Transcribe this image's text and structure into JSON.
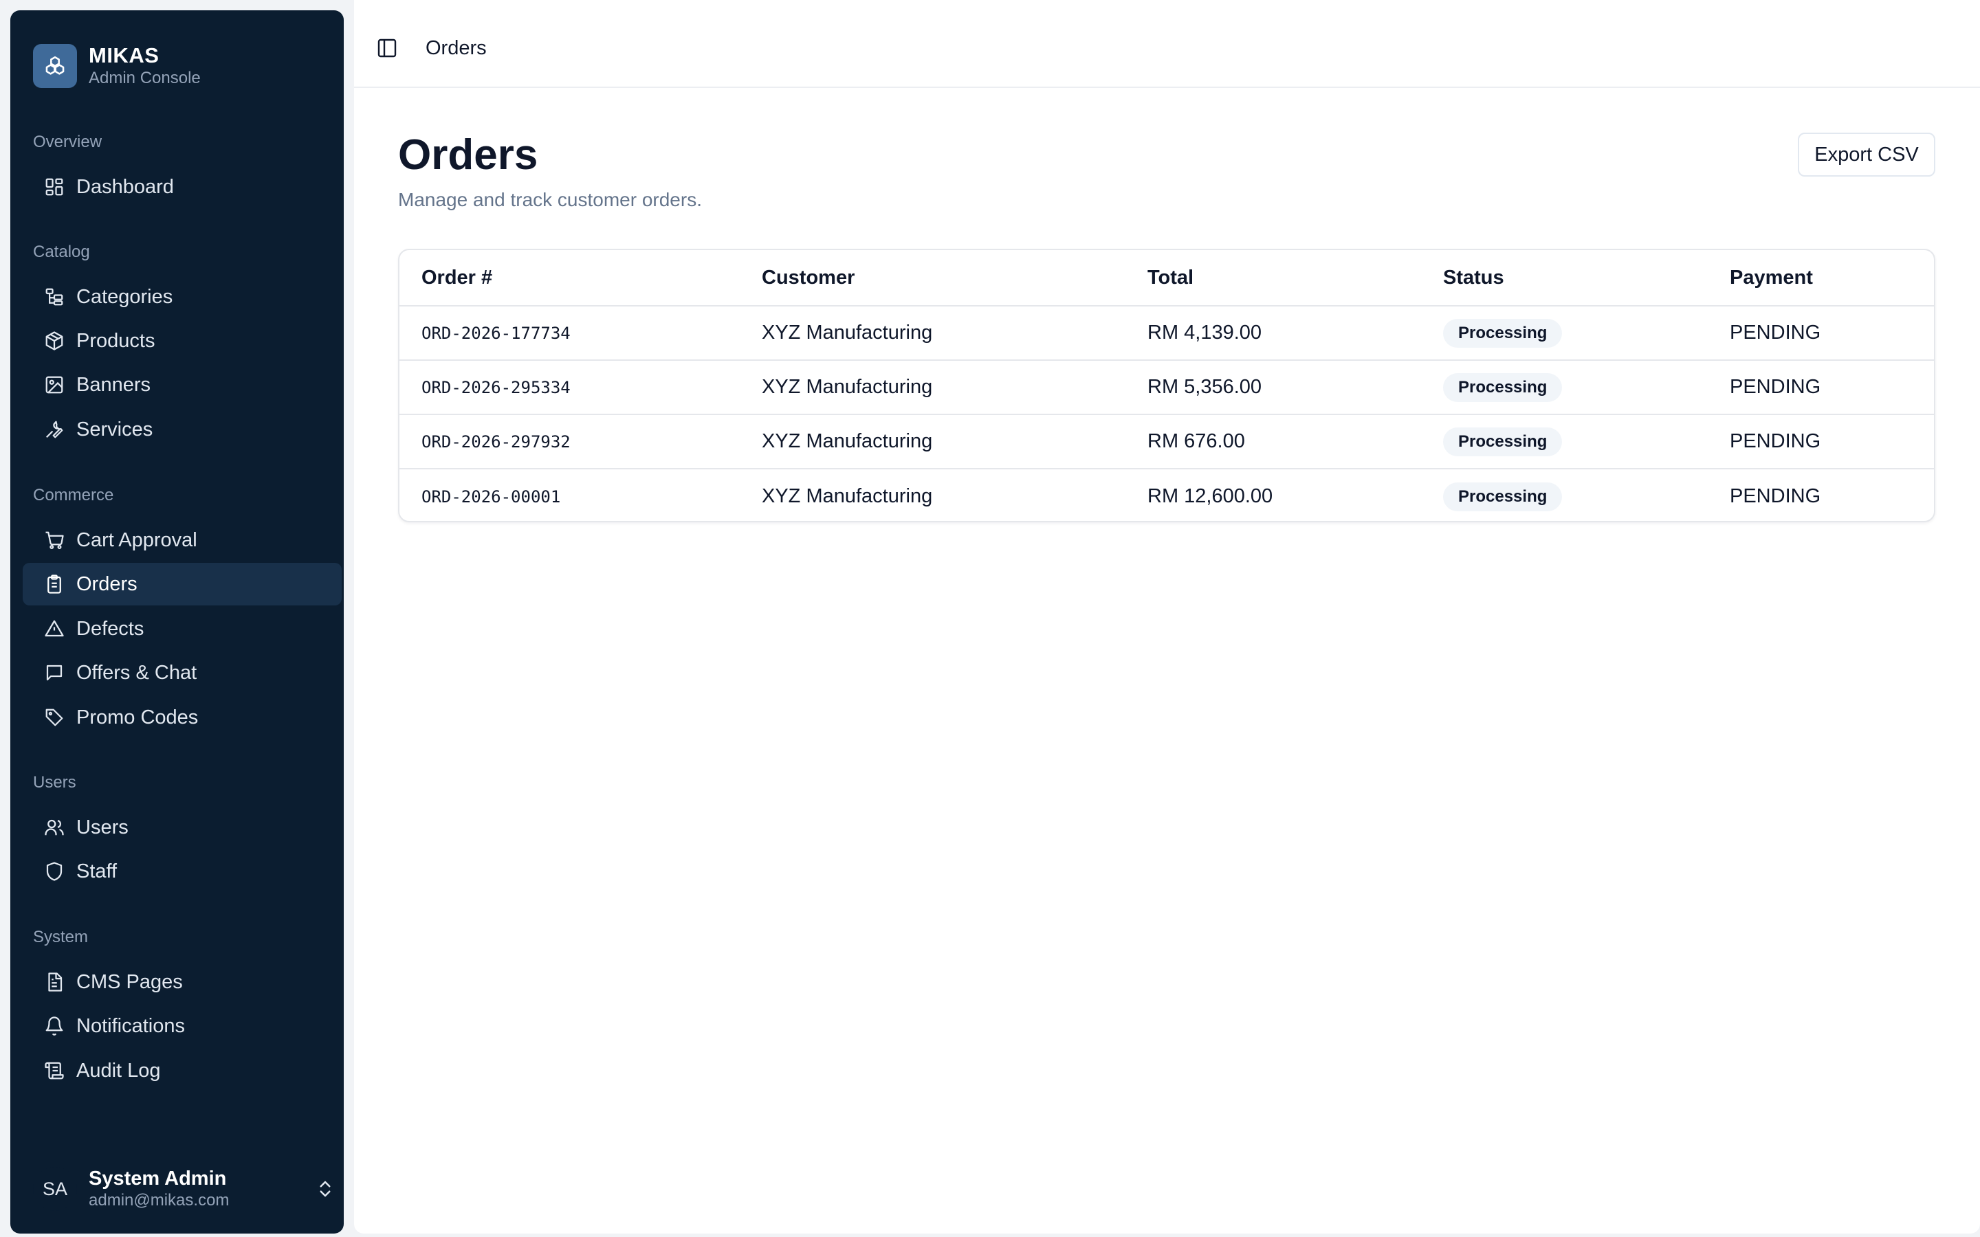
{
  "brand": {
    "name": "MIKAS",
    "subtitle": "Admin Console"
  },
  "sidebar": {
    "sections": {
      "overview": "Overview",
      "catalog": "Catalog",
      "commerce": "Commerce",
      "users": "Users",
      "system": "System"
    },
    "items": {
      "dashboard": "Dashboard",
      "categories": "Categories",
      "products": "Products",
      "banners": "Banners",
      "services": "Services",
      "cart_approval": "Cart Approval",
      "orders": "Orders",
      "defects": "Defects",
      "offers_chat": "Offers & Chat",
      "promo_codes": "Promo Codes",
      "users": "Users",
      "staff": "Staff",
      "cms_pages": "CMS Pages",
      "notifications": "Notifications",
      "audit_log": "Audit Log"
    },
    "active_item": "orders"
  },
  "user": {
    "initials": "SA",
    "name": "System Admin",
    "email": "admin@mikas.com"
  },
  "topbar": {
    "title": "Orders"
  },
  "page": {
    "title": "Orders",
    "subtitle": "Manage and track customer orders.",
    "export_label": "Export CSV"
  },
  "table": {
    "headers": [
      "Order #",
      "Customer",
      "Total",
      "Status",
      "Payment"
    ],
    "rows": [
      {
        "order": "ORD-2026-177734",
        "customer": "XYZ Manufacturing",
        "total": "RM 4,139.00",
        "status": "Processing",
        "payment": "PENDING"
      },
      {
        "order": "ORD-2026-295334",
        "customer": "XYZ Manufacturing",
        "total": "RM 5,356.00",
        "status": "Processing",
        "payment": "PENDING"
      },
      {
        "order": "ORD-2026-297932",
        "customer": "XYZ Manufacturing",
        "total": "RM 676.00",
        "status": "Processing",
        "payment": "PENDING"
      },
      {
        "order": "ORD-2026-00001",
        "customer": "XYZ Manufacturing",
        "total": "RM 12,600.00",
        "status": "Processing",
        "payment": "PENDING"
      }
    ]
  },
  "colors": {
    "sidebar_bg": "#0b1d30",
    "sidebar_active": "#18304a",
    "brand_logo": "#3f6a99",
    "badge_bg": "#f1f5f9"
  }
}
